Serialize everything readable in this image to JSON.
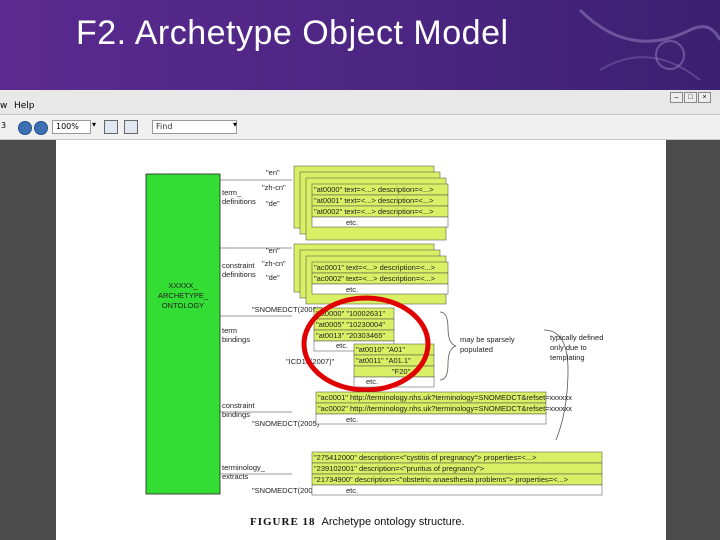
{
  "slide": {
    "title": "F2. Archetype Object Model"
  },
  "menubar": {
    "items": [
      "w",
      "Help"
    ]
  },
  "toolbar": {
    "page_prefix": "3",
    "zoom": "100%",
    "find_placeholder": "Find"
  },
  "figure": {
    "caption_label": "FIGURE 18",
    "caption_text": "Archetype ontology structure.",
    "root": "XXXXX_ ARCHETYPE_ ONTOLOGY",
    "groups": {
      "term_definitions": "term_ definitions",
      "constraint_definitions": "constraint definitions",
      "term_bindings": "term bindings",
      "constraint_bindings": "constraint bindings",
      "terminology_extracts": "terminology_ extracts"
    },
    "langs": [
      "\"en\"",
      "\"zh-cn\"",
      "\"de\""
    ],
    "term_rows": [
      "\"at0000\" text=<...> description=<...>",
      "\"at0001\" text=<...> description=<...>",
      "\"at0002\" text=<...> description=<...>"
    ],
    "constraint_rows": [
      "\"ac0001\" text=<...> description=<...>",
      "\"ac0002\" text=<...> description=<...>"
    ],
    "etc": "etc.",
    "snomed": "\"SNOMEDCT(2005)\"",
    "icd": "\"ICD10(2007)\"",
    "binding_rows": [
      [
        "\"at0000\"",
        "\"10002631\""
      ],
      [
        "\"at0005\"",
        "\"10230004\""
      ],
      [
        "\"at0013\"",
        "\"20303465\""
      ]
    ],
    "icd_rows": [
      [
        "\"at0010\"",
        "\"A01\""
      ],
      [
        "\"at0011\"",
        "\"A01.1\""
      ],
      [
        "",
        "\"F20\""
      ]
    ],
    "constraint_binding_rows": [
      [
        "\"ac0001\"",
        "http://terminology.nhs.uk?terminology=SNOMEDCT&refset=xxxxxx"
      ],
      [
        "\"ac0002\"",
        "http://terminology.nhs.uk?terminology=SNOMEDCT&refset=xxxxxx"
      ]
    ],
    "extract_rows": [
      [
        "\"275412000\"",
        "description=<\"cystitis of pregnancy\"> properties=<...>"
      ],
      [
        "\"239102001\"",
        "description=<\"pruritus of pregnancy\">"
      ],
      [
        "\"21734900\"",
        "description=<\"obstetric anaesthesia problems\"> properties=<...>"
      ]
    ],
    "note_sparse": "may be sparsely populated",
    "note_template": "typically defined only due to templating"
  },
  "colors": {
    "green": "#33dd33",
    "row_green": "#d9f066",
    "banner": "#5b2a90",
    "highlight": "#e00000"
  }
}
